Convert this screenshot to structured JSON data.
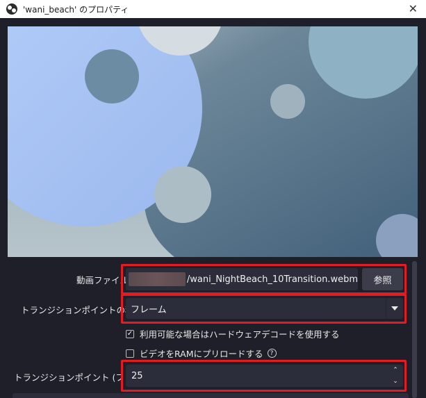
{
  "window": {
    "title": "'wani_beach' のプロパティ",
    "close_glyph": "✕"
  },
  "preview": {
    "colors": {
      "bg_dark": "#4b6b80",
      "bg_light": "#a7b8c3",
      "big_circle": "#a9c6f5",
      "top_circle": "#d5dde2",
      "right_circle": "#8daec0",
      "small_circle": "#6b8ca3",
      "mid_circle": "#9fb3bf",
      "low_circle": "#b0bfc7",
      "corner_circle": "#8da0bf"
    }
  },
  "fields": {
    "video_file": {
      "label": "動画ファイル",
      "value": "/wani_NightBeach_10Transition.webm",
      "browse_label": "参照"
    },
    "transition_type": {
      "label": "トランジションポイントの種類",
      "value": "フレーム"
    },
    "hw_decode": {
      "label": "利用可能な場合はハードウェアデコードを使用する",
      "checked_glyph": "✓"
    },
    "preload_ram": {
      "label": "ビデオをRAMにプリロードする",
      "help_glyph": "?"
    },
    "transition_point": {
      "label": "トランジションポイント (フレーム)",
      "value": "25",
      "up_glyph": "⌃",
      "down_glyph": "⌄"
    }
  },
  "accent": {
    "highlight": "#e31b23"
  }
}
